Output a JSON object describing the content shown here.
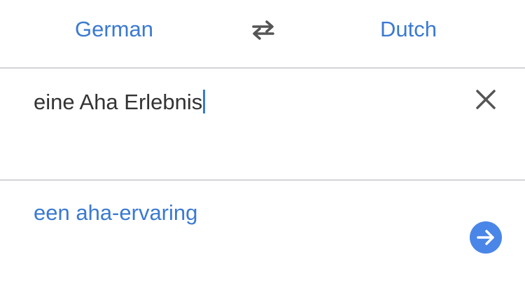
{
  "languages": {
    "source": "German",
    "target": "Dutch",
    "swap_icon": "swap-arrows-icon"
  },
  "input": {
    "text": "eine Aha Erlebnis",
    "clear_icon": "close-icon"
  },
  "result": {
    "text": "een aha-ervaring",
    "go_icon": "arrow-right-icon"
  },
  "colors": {
    "accent": "#3a7ad1",
    "button": "#4a86e8",
    "text": "#333333",
    "divider": "#d3d3d6"
  }
}
